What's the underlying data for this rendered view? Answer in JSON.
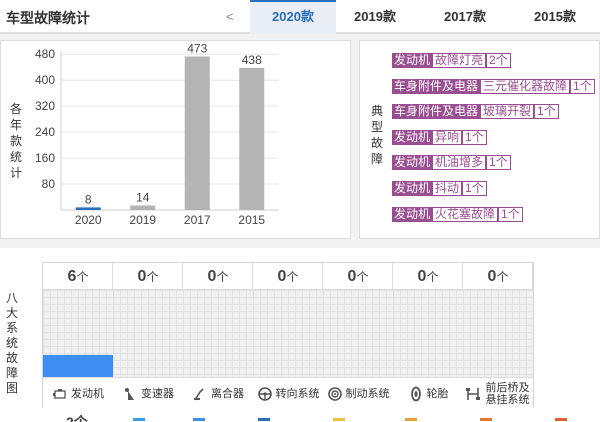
{
  "header": {
    "title": "车型故障统计",
    "prev_arrow": "<",
    "tabs": [
      {
        "label": "2020款",
        "active": true
      },
      {
        "label": "2019款",
        "active": false
      },
      {
        "label": "2017款",
        "active": false
      },
      {
        "label": "2015款",
        "active": false
      }
    ]
  },
  "chart_panel": {
    "label": "各年款统计"
  },
  "chart_data": {
    "type": "bar",
    "categories": [
      "2020",
      "2019",
      "2017",
      "2015"
    ],
    "values": [
      8,
      14,
      473,
      438
    ],
    "ylim": [
      0,
      490
    ],
    "yticks": [
      80,
      160,
      240,
      320,
      400,
      480
    ],
    "highlight_index": 0,
    "colors": {
      "highlight": "#2a6ebc",
      "default": "#b4b4b4"
    }
  },
  "faults": {
    "label": "典型故障",
    "items": [
      {
        "category": "发动机",
        "issue": "故障灯亮",
        "count": "2个"
      },
      {
        "category": "车身附件及电器",
        "issue": "三元催化器故障",
        "count": "1个"
      },
      {
        "category": "车身附件及电器",
        "issue": "玻璃开裂",
        "count": "1个"
      },
      {
        "category": "发动机",
        "issue": "异响",
        "count": "1个"
      },
      {
        "category": "发动机",
        "issue": "机油增多",
        "count": "1个"
      },
      {
        "category": "发动机",
        "issue": "抖动",
        "count": "1个"
      },
      {
        "category": "发动机",
        "issue": "火花塞故障",
        "count": "1个"
      }
    ]
  },
  "systems": {
    "label": "八大系统故障图",
    "unit": "个",
    "max": 6,
    "items": [
      {
        "name": "发动机",
        "count": "6",
        "value": 6,
        "icon": "engine-icon"
      },
      {
        "name": "变速器",
        "count": "0",
        "value": 0,
        "icon": "gear-shift-icon"
      },
      {
        "name": "离合器",
        "count": "0",
        "value": 0,
        "icon": "clutch-pedal-icon"
      },
      {
        "name": "转向系统",
        "count": "0",
        "value": 0,
        "icon": "steering-wheel-icon"
      },
      {
        "name": "制动系统",
        "count": "0",
        "value": 0,
        "icon": "brake-disc-icon"
      },
      {
        "name": "轮胎",
        "count": "0",
        "value": 0,
        "icon": "tire-icon"
      },
      {
        "name": "前后桥及悬挂系统",
        "count": "0",
        "value": 0,
        "icon": "suspension-icon"
      }
    ],
    "next_peek": "2个"
  },
  "colors": {
    "accent": "#2a6ebc",
    "fault_tag": "#9a4e92",
    "system_fill": "#3d8ef0"
  }
}
